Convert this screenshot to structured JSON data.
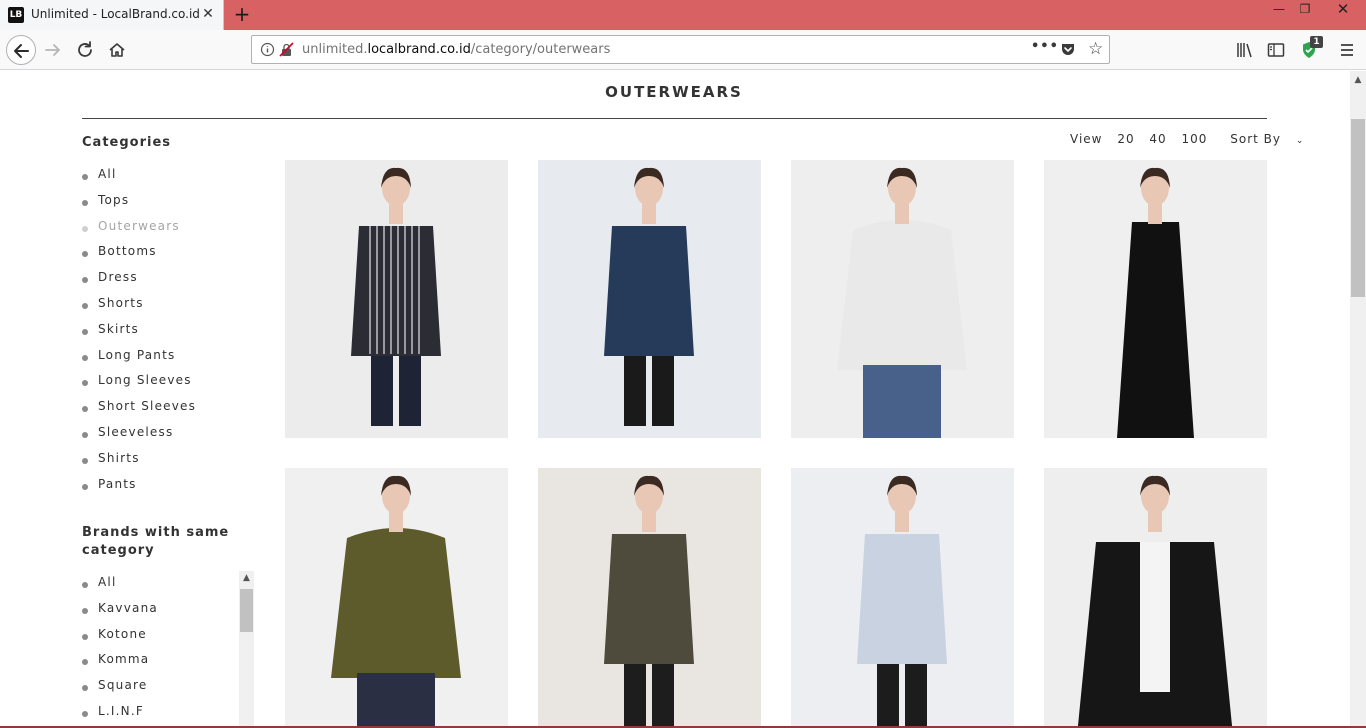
{
  "browser": {
    "tab_favicon": "LB",
    "tab_title": "Unlimited - LocalBrand.co.id",
    "tab_close": "✕",
    "new_tab": "+",
    "window_controls": {
      "minimize": "—",
      "maximize": "❐",
      "close": "✕"
    },
    "url_prefix": "unlimited.",
    "url_domain": "localbrand.co.id",
    "url_path": "/category/outerwears",
    "url_more": "•••",
    "shield_badge": "1",
    "icons": [
      "back-arrow-icon",
      "forward-arrow-icon",
      "reload-icon",
      "home-icon",
      "info-icon",
      "insecure-lock-icon",
      "pocket-icon",
      "star-icon",
      "library-icon",
      "sidebar-icon",
      "shield-icon",
      "hamburger-menu-icon"
    ]
  },
  "page": {
    "title": "OUTERWEARS",
    "categories_heading": "Categories",
    "categories": [
      {
        "label": "All",
        "active": false
      },
      {
        "label": "Tops",
        "active": false
      },
      {
        "label": "Outerwears",
        "active": true
      },
      {
        "label": "Bottoms",
        "active": false
      },
      {
        "label": "Dress",
        "active": false
      },
      {
        "label": "Shorts",
        "active": false
      },
      {
        "label": "Skirts",
        "active": false
      },
      {
        "label": "Long Pants",
        "active": false
      },
      {
        "label": "Long Sleeves",
        "active": false
      },
      {
        "label": "Short Sleeves",
        "active": false
      },
      {
        "label": "Sleeveless",
        "active": false
      },
      {
        "label": "Shirts",
        "active": false
      },
      {
        "label": "Pants",
        "active": false
      }
    ],
    "brands_heading": "Brands with same category",
    "brands": [
      "All",
      "Kavvana",
      "Kotone",
      "Komma",
      "Square",
      "L.I.N.F"
    ],
    "view": {
      "label": "View",
      "options": [
        "20",
        "40",
        "100"
      ],
      "sort_label": "Sort By",
      "sort_caret": "⌄"
    },
    "products": [
      {
        "name": "striped-vest-outerwear-image",
        "bg": "#ececec",
        "top": "#2c2c34",
        "bottom": "#1e2435",
        "pattern": "stripes"
      },
      {
        "name": "navy-shirt-jacket-image",
        "bg": "#e7eaee",
        "top": "#253b59",
        "bottom": "#1a1a1a",
        "pattern": "plain"
      },
      {
        "name": "white-hoodie-image",
        "bg": "#eeeeee",
        "top": "#e9e9e9",
        "bottom": "#47618a",
        "pattern": "hoodie"
      },
      {
        "name": "black-sleeveless-dress-image",
        "bg": "#efefef",
        "top": "#111111",
        "bottom": "#111111",
        "pattern": "dress"
      },
      {
        "name": "olive-hoodie-image",
        "bg": "#f0f0f0",
        "top": "#5d5a2b",
        "bottom": "#2a2f44",
        "pattern": "hoodie"
      },
      {
        "name": "olive-bomber-jacket-image",
        "bg": "#e9e6e2",
        "top": "#4e4b3c",
        "bottom": "#1d1d1d",
        "pattern": "plain"
      },
      {
        "name": "light-blue-jacket-image",
        "bg": "#eceef1",
        "top": "#c8d2e0",
        "bottom": "#1c1c1c",
        "pattern": "plain"
      },
      {
        "name": "black-sheer-cardigan-image",
        "bg": "#eeeeee",
        "top": "#161616",
        "bottom": "#161616",
        "pattern": "cardigan"
      }
    ]
  }
}
